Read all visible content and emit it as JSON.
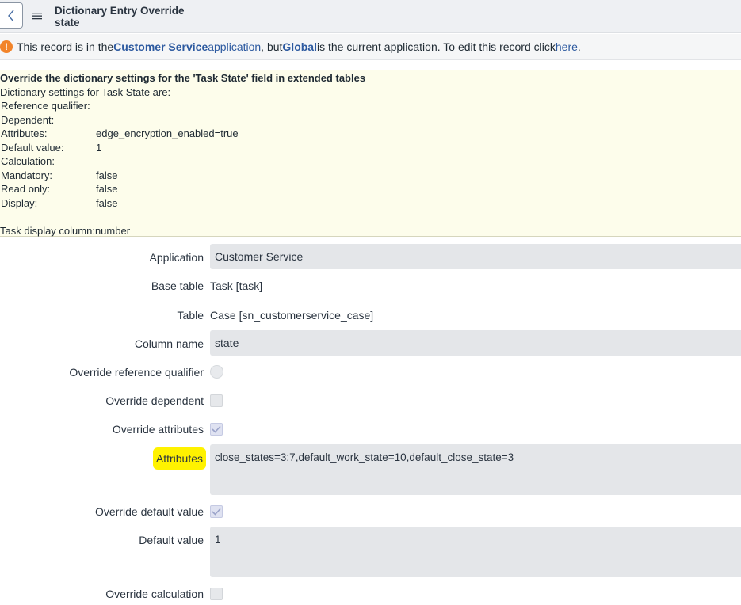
{
  "header": {
    "title": "Dictionary Entry Override",
    "subtitle": "state"
  },
  "notice": {
    "text_prefix": "This record is in the ",
    "app_link": "Customer Service",
    "app_suffix": " application",
    "text_mid": ", but ",
    "global_link": "Global",
    "text_after": " is the current application. To edit this record click ",
    "here_link": "here",
    "period": "."
  },
  "info": {
    "title": "Override the dictionary settings for the 'Task State' field in extended tables",
    "subtitle": "Dictionary settings for Task State are:",
    "rows": [
      {
        "key": "Reference qualifier:",
        "value": ""
      },
      {
        "key": "Dependent:",
        "value": ""
      },
      {
        "key": "Attributes:",
        "value": "edge_encryption_enabled=true"
      },
      {
        "key": "Default value:",
        "value": "1"
      },
      {
        "key": "Calculation:",
        "value": ""
      },
      {
        "key": "Mandatory:",
        "value": "false"
      },
      {
        "key": "Read only:",
        "value": "false"
      },
      {
        "key": "Display:",
        "value": "false"
      }
    ],
    "footer": "Task display column:number"
  },
  "form": {
    "application": {
      "label": "Application",
      "value": "Customer Service"
    },
    "base_table": {
      "label": "Base table",
      "value": "Task [task]"
    },
    "table": {
      "label": "Table",
      "value": "Case [sn_customerservice_case]"
    },
    "column_name": {
      "label": "Column name",
      "value": "state"
    },
    "override_ref_qual": {
      "label": "Override reference qualifier",
      "checked": false
    },
    "override_dependent": {
      "label": "Override dependent",
      "checked": false
    },
    "override_attributes": {
      "label": "Override attributes",
      "checked": true
    },
    "attributes": {
      "label": "Attributes",
      "value": "close_states=3;7,default_work_state=10,default_close_state=3"
    },
    "override_default": {
      "label": "Override default value",
      "checked": true
    },
    "default_value": {
      "label": "Default value",
      "value": "1"
    },
    "override_calculation": {
      "label": "Override calculation",
      "checked": false
    }
  },
  "colors": {
    "link": "#2d5aa0",
    "warning": "#f2842a",
    "highlight": "#fff200",
    "info_bg": "#fdfdeb"
  }
}
